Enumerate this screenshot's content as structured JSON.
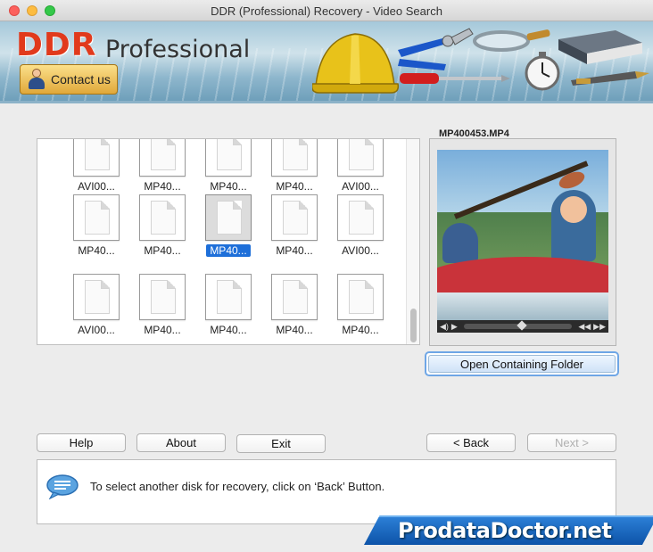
{
  "window": {
    "title": "DDR (Professional) Recovery - Video Search"
  },
  "banner": {
    "logo_main": "DDR",
    "logo_sub": "Professional",
    "contact_label": "Contact us"
  },
  "files": {
    "rows": [
      [
        "AVI00...",
        "MP40...",
        "MP40...",
        "MP40...",
        "AVI00..."
      ],
      [
        "MP40...",
        "MP40...",
        "MP40...",
        "MP40...",
        "AVI00..."
      ],
      [
        "AVI00...",
        "MP40...",
        "MP40...",
        "MP40...",
        "MP40..."
      ]
    ],
    "selected": {
      "row": 1,
      "col": 2
    }
  },
  "preview": {
    "file_name": "MP400453.MP4",
    "open_folder_label": "Open Containing Folder"
  },
  "buttons": {
    "help": "Help",
    "about": "About",
    "exit": "Exit",
    "back": "< Back",
    "next": "Next >"
  },
  "status": {
    "message": "To select another disk for recovery, click on ‘Back’ Button."
  },
  "watermark": {
    "text": "ProdataDoctor.net"
  },
  "colors": {
    "accent": "#1e6fd9",
    "logo_red": "#e13a1c",
    "watermark_blue": "#0d53a8"
  }
}
